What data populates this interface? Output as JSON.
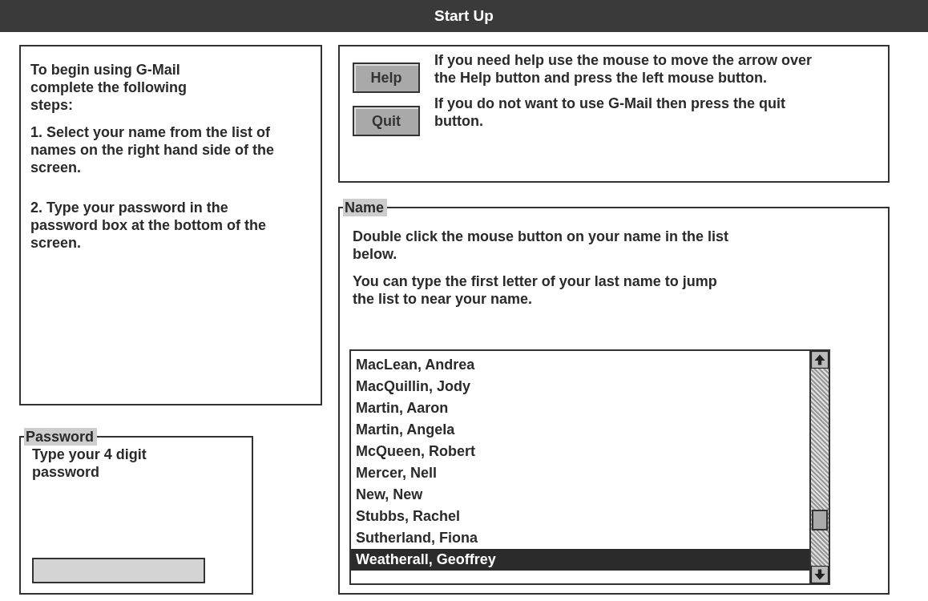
{
  "window": {
    "title": "Start Up"
  },
  "instructions": {
    "intro": "To begin using G-Mail complete the following steps:",
    "steps": [
      "1.  Select your name from the list of names on the right hand side of the screen.",
      "2. Type your password in the password box at the bottom of the screen."
    ]
  },
  "help": [
    {
      "button": "Help",
      "text": "If you need help use the mouse to move the arrow over the Help button and press the left mouse button."
    },
    {
      "button": "Quit",
      "text": "If you do not want to use G-Mail then press the quit button."
    }
  ],
  "password": {
    "legend": "Password",
    "hint": "Type your 4 digit password"
  },
  "name": {
    "legend": "Name",
    "paragraphs": [
      "Double click the mouse button on your name in the list below.",
      "You can type the first letter of your last name to jump the list to near your name."
    ],
    "list": [
      {
        "label": "MacLean, Andrea",
        "selected": false
      },
      {
        "label": "MacQuillin, Jody",
        "selected": false
      },
      {
        "label": "Martin, Aaron",
        "selected": false
      },
      {
        "label": "Martin, Angela",
        "selected": false
      },
      {
        "label": "McQueen, Robert",
        "selected": false
      },
      {
        "label": "Mercer, Nell",
        "selected": false
      },
      {
        "label": "New, New",
        "selected": false
      },
      {
        "label": "Stubbs, Rachel",
        "selected": false
      },
      {
        "label": "Sutherland, Fiona",
        "selected": false
      },
      {
        "label": "Weatherall, Geoffrey",
        "selected": true
      }
    ]
  }
}
